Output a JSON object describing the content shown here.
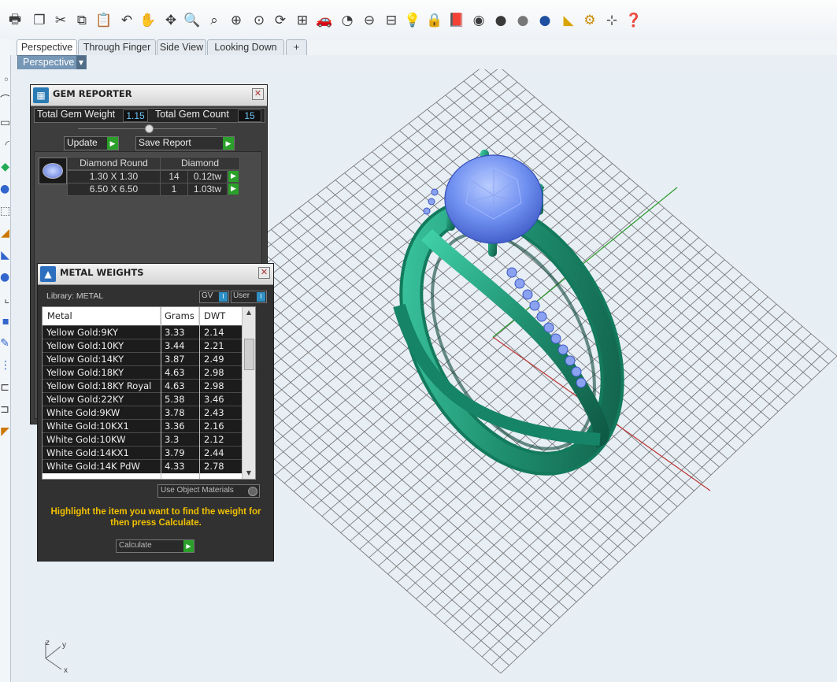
{
  "toolbar": {
    "icons": [
      "print-icon",
      "new-document-icon",
      "cut-icon",
      "copy-icon",
      "paste-icon",
      "undo-icon",
      "pan-hand-icon",
      "move-icon",
      "zoom-icon",
      "zoom-window-icon",
      "zoom-extents-icon",
      "zoom-selected-icon",
      "rotate-view-icon",
      "four-viewports-icon",
      "car-icon",
      "render-icon",
      "circle-tool-icon",
      "grid-icon",
      "lightbulb-icon",
      "lock-icon",
      "material-book-icon",
      "color-wheel-icon",
      "shaded-sphere-icon",
      "rendered-sphere-icon",
      "blue-sphere-icon",
      "options-icon",
      "settings-gear-icon",
      "snap-icon",
      "help-icon"
    ]
  },
  "tabs": [
    {
      "label": "Perspective",
      "active": true
    },
    {
      "label": "Through Finger",
      "active": false
    },
    {
      "label": "Side View",
      "active": false
    },
    {
      "label": "Looking Down",
      "active": false
    },
    {
      "label": "+",
      "active": false
    }
  ],
  "viewport": {
    "label": "Perspective",
    "axes": {
      "x": "x",
      "y": "y",
      "z": "z"
    }
  },
  "gem_reporter": {
    "title": "GEM REPORTER",
    "total_weight_label": "Total Gem Weight",
    "total_weight": "1.15",
    "total_count_label": "Total Gem Count",
    "total_count": "15",
    "update_label": "Update",
    "save_report_label": "Save Report",
    "header_shape": "Diamond Round",
    "header_type": "Diamond",
    "rows": [
      {
        "size": "1.30 X 1.30",
        "count": "14",
        "weight": "0.12tw"
      },
      {
        "size": "6.50 X 6.50",
        "count": "1",
        "weight": "1.03tw"
      }
    ]
  },
  "metal_weights": {
    "title": "METAL WEIGHTS",
    "library_label": "Library: METAL",
    "gv_label": "GV",
    "user_label": "User",
    "columns": [
      "Metal",
      "Grams",
      "DWT"
    ],
    "rows": [
      {
        "metal": "Yellow Gold:9KY",
        "grams": "3.33",
        "dwt": "2.14"
      },
      {
        "metal": "Yellow Gold:10KY",
        "grams": "3.44",
        "dwt": "2.21"
      },
      {
        "metal": "Yellow Gold:14KY",
        "grams": "3.87",
        "dwt": "2.49"
      },
      {
        "metal": "Yellow Gold:18KY",
        "grams": "4.63",
        "dwt": "2.98"
      },
      {
        "metal": "Yellow Gold:18KY Royal",
        "grams": "4.63",
        "dwt": "2.98"
      },
      {
        "metal": "Yellow Gold:22KY",
        "grams": "5.38",
        "dwt": "3.46"
      },
      {
        "metal": "White Gold:9KW",
        "grams": "3.78",
        "dwt": "2.43"
      },
      {
        "metal": "White Gold:10KX1",
        "grams": "3.36",
        "dwt": "2.16"
      },
      {
        "metal": "White Gold:10KW",
        "grams": "3.3",
        "dwt": "2.12"
      },
      {
        "metal": "White Gold:14KX1",
        "grams": "3.79",
        "dwt": "2.44"
      },
      {
        "metal": "White Gold:14K PdW",
        "grams": "4.33",
        "dwt": "2.78"
      }
    ],
    "use_object_materials": "Use Object Materials",
    "instruction": "Highlight the item you want to find the weight for then press Calculate.",
    "calculate_label": "Calculate"
  },
  "colors": {
    "ring_metal": "#1f8f6f",
    "gem_blue": "#6f8ff0",
    "viewport_bg": "#e7eef4",
    "panel_bg": "#3d3d3d",
    "instruction_text": "#f0c000"
  }
}
